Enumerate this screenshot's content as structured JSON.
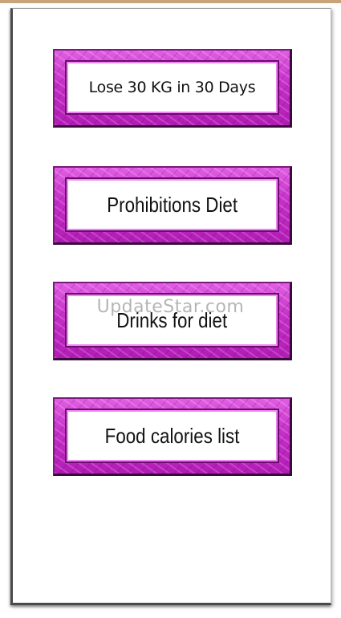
{
  "menu": {
    "items": [
      {
        "label": "Lose 30 KG in 30 Days"
      },
      {
        "label": "Prohibitions Diet"
      },
      {
        "label": "Drinks for diet"
      },
      {
        "label": "Food calories list"
      }
    ]
  },
  "watermark": {
    "text": "UpdateStar.com"
  },
  "colors": {
    "button_frame": "#c52fc8",
    "button_highlight": "#f184f3",
    "button_shadow": "#3a0a3c",
    "background": "#ffffff"
  }
}
